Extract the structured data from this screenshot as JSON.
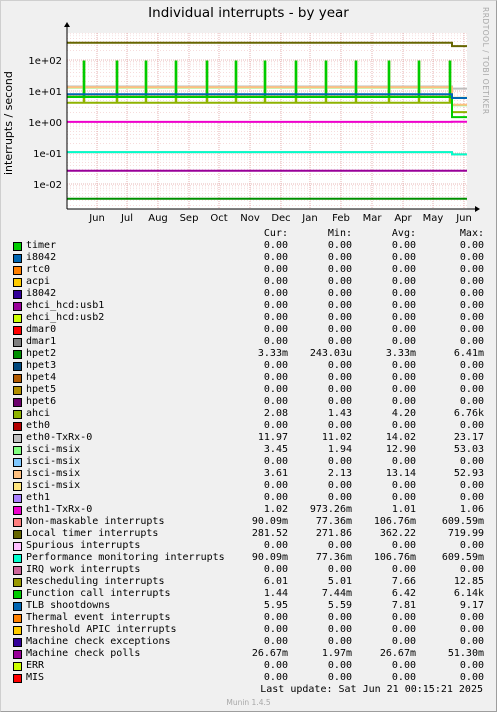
{
  "chart_data": {
    "type": "line",
    "title": "Individual interrupts - by year",
    "ylabel": "interrupts / second",
    "yscale": "log",
    "ylim": [
      0.002,
      700
    ],
    "yticks": [
      "1e+02",
      "1e+01",
      "1e+00",
      "1e-01",
      "1e-02"
    ],
    "ytick_values": [
      100,
      10,
      1,
      0.1,
      0.01
    ],
    "xticks": [
      "Jun",
      "Jul",
      "Aug",
      "Sep",
      "Oct",
      "Nov",
      "Dec",
      "Jan",
      "Feb",
      "Mar",
      "Apr",
      "May",
      "Jun"
    ],
    "grid": true,
    "columns": [
      "Cur:",
      "Min:",
      "Avg:",
      "Max:"
    ],
    "series": [
      {
        "name": "timer",
        "color": "#00cc00",
        "values": [
          "0.00",
          "0.00",
          "0.00",
          "0.00"
        ]
      },
      {
        "name": "i8042",
        "color": "#0066b3",
        "values": [
          "0.00",
          "0.00",
          "0.00",
          "0.00"
        ]
      },
      {
        "name": "rtc0",
        "color": "#ff8000",
        "values": [
          "0.00",
          "0.00",
          "0.00",
          "0.00"
        ]
      },
      {
        "name": "acpi",
        "color": "#ffcc00",
        "values": [
          "0.00",
          "0.00",
          "0.00",
          "0.00"
        ]
      },
      {
        "name": "i8042",
        "color": "#330099",
        "values": [
          "0.00",
          "0.00",
          "0.00",
          "0.00"
        ]
      },
      {
        "name": "ehci_hcd:usb1",
        "color": "#990099",
        "values": [
          "0.00",
          "0.00",
          "0.00",
          "0.00"
        ]
      },
      {
        "name": "ehci_hcd:usb2",
        "color": "#ccff00",
        "values": [
          "0.00",
          "0.00",
          "0.00",
          "0.00"
        ]
      },
      {
        "name": "dmar0",
        "color": "#ff0000",
        "values": [
          "0.00",
          "0.00",
          "0.00",
          "0.00"
        ]
      },
      {
        "name": "dmar1",
        "color": "#808080",
        "values": [
          "0.00",
          "0.00",
          "0.00",
          "0.00"
        ]
      },
      {
        "name": "hpet2",
        "color": "#008f00",
        "values": [
          "3.33m",
          "243.03u",
          "3.33m",
          "6.41m"
        ]
      },
      {
        "name": "hpet3",
        "color": "#00487d",
        "values": [
          "0.00",
          "0.00",
          "0.00",
          "0.00"
        ]
      },
      {
        "name": "hpet4",
        "color": "#b35a00",
        "values": [
          "0.00",
          "0.00",
          "0.00",
          "0.00"
        ]
      },
      {
        "name": "hpet5",
        "color": "#b38f00",
        "values": [
          "0.00",
          "0.00",
          "0.00",
          "0.00"
        ]
      },
      {
        "name": "hpet6",
        "color": "#6b006b",
        "values": [
          "0.00",
          "0.00",
          "0.00",
          "0.00"
        ]
      },
      {
        "name": "ahci",
        "color": "#8fb300",
        "values": [
          "2.08",
          "1.43",
          "4.20",
          "6.76k"
        ]
      },
      {
        "name": "eth0",
        "color": "#b30000",
        "values": [
          "0.00",
          "0.00",
          "0.00",
          "0.00"
        ]
      },
      {
        "name": "eth0-TxRx-0",
        "color": "#bebebe",
        "values": [
          "11.97",
          "11.02",
          "14.02",
          "23.17"
        ]
      },
      {
        "name": "isci-msix",
        "color": "#80ff80",
        "values": [
          "3.45",
          "1.94",
          "12.90",
          "53.03"
        ]
      },
      {
        "name": "isci-msix",
        "color": "#80c9ff",
        "values": [
          "0.00",
          "0.00",
          "0.00",
          "0.00"
        ]
      },
      {
        "name": "isci-msix",
        "color": "#ffc080",
        "values": [
          "3.61",
          "2.13",
          "13.14",
          "52.93"
        ]
      },
      {
        "name": "isci-msix",
        "color": "#ffe680",
        "values": [
          "0.00",
          "0.00",
          "0.00",
          "0.00"
        ]
      },
      {
        "name": "eth1",
        "color": "#aa80ff",
        "values": [
          "0.00",
          "0.00",
          "0.00",
          "0.00"
        ]
      },
      {
        "name": "eth1-TxRx-0",
        "color": "#ee00cc",
        "values": [
          "1.02",
          "973.26m",
          "1.01",
          "1.06"
        ]
      },
      {
        "name": "Non-maskable interrupts",
        "color": "#ff8080",
        "values": [
          "90.09m",
          "77.36m",
          "106.76m",
          "609.59m"
        ]
      },
      {
        "name": "Local timer interrupts",
        "color": "#666600",
        "values": [
          "281.52",
          "271.86",
          "362.22",
          "719.99"
        ]
      },
      {
        "name": "Spurious interrupts",
        "color": "#ffbfff",
        "values": [
          "0.00",
          "0.00",
          "0.00",
          "0.00"
        ]
      },
      {
        "name": "Performance monitoring interrupts",
        "color": "#00ffcc",
        "values": [
          "90.09m",
          "77.36m",
          "106.76m",
          "609.59m"
        ]
      },
      {
        "name": "IRQ work interrupts",
        "color": "#cc6699",
        "values": [
          "0.00",
          "0.00",
          "0.00",
          "0.00"
        ]
      },
      {
        "name": "Rescheduling interrupts",
        "color": "#999900",
        "values": [
          "6.01",
          "5.01",
          "7.66",
          "12.85"
        ]
      },
      {
        "name": "Function call interrupts",
        "color": "#00cc00",
        "values": [
          "1.44",
          "7.44m",
          "6.42",
          "6.14k"
        ]
      },
      {
        "name": "TLB shootdowns",
        "color": "#0066b3",
        "values": [
          "5.95",
          "5.59",
          "7.81",
          "9.17"
        ]
      },
      {
        "name": "Thermal event interrupts",
        "color": "#ff8000",
        "values": [
          "0.00",
          "0.00",
          "0.00",
          "0.00"
        ]
      },
      {
        "name": "Threshold APIC interrupts",
        "color": "#ffcc00",
        "values": [
          "0.00",
          "0.00",
          "0.00",
          "0.00"
        ]
      },
      {
        "name": "Machine check exceptions",
        "color": "#330099",
        "values": [
          "0.00",
          "0.00",
          "0.00",
          "0.00"
        ]
      },
      {
        "name": "Machine check polls",
        "color": "#990099",
        "values": [
          "26.67m",
          "1.97m",
          "26.67m",
          "51.30m"
        ]
      },
      {
        "name": "ERR",
        "color": "#ccff00",
        "values": [
          "0.00",
          "0.00",
          "0.00",
          "0.00"
        ]
      },
      {
        "name": "MIS",
        "color": "#ff0000",
        "values": [
          "0.00",
          "0.00",
          "0.00",
          "0.00"
        ]
      }
    ]
  },
  "side_text": "RRDTOOL / TOBI OETIKER",
  "last_update": "Last update:  Sat Jun 21 00:15:21 2025",
  "footer": "Munin 1.4.5"
}
